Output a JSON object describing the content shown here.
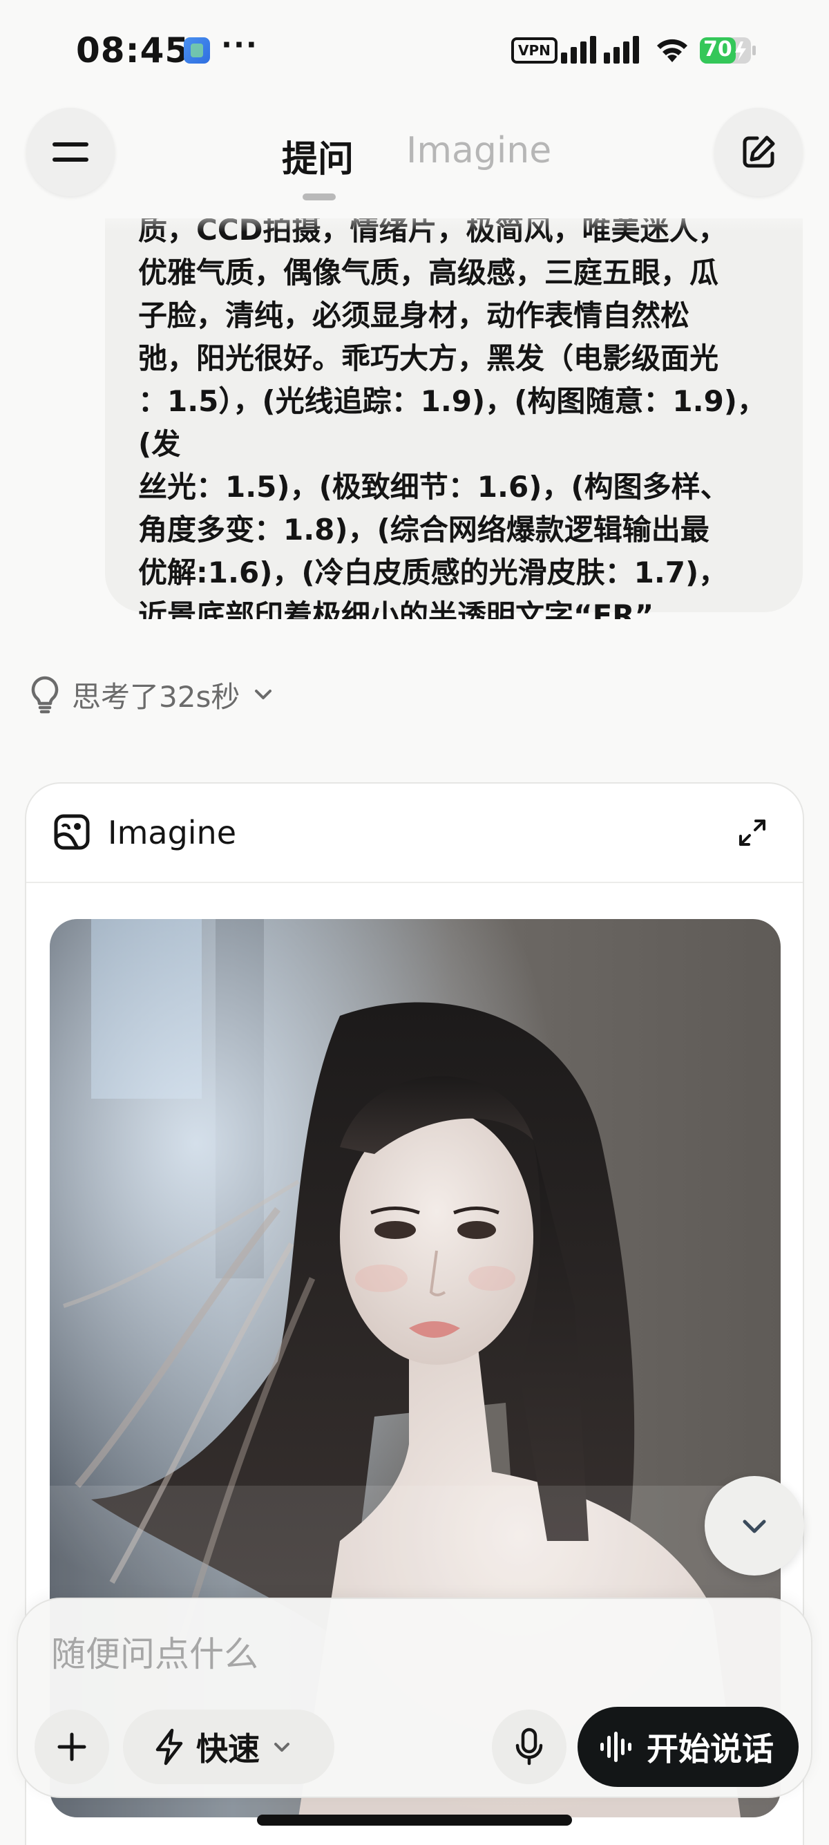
{
  "status_bar": {
    "time": "08:45",
    "more": "···",
    "vpn": "VPN",
    "battery": "70"
  },
  "header": {
    "tabs": [
      {
        "label": "提问",
        "active": true
      },
      {
        "label": "Imagine",
        "active": false
      }
    ],
    "icons": {
      "menu": "menu-icon",
      "edit": "edit-icon"
    }
  },
  "message": {
    "text": "质，CCD拍摄，情绪片，极简风，唯美迷人，\n优雅气质，偶像气质，高级感，三庭五眼，瓜\n子脸，清纯，必须显身材，动作表情自然松\n弛，阳光很好。乖巧大方，黑发（电影级面光\n：1.5），(光线追踪：1.9)，(构图随意：1.9)，(发\n丝光：1.5)，(极致细节：1.6)，(构图多样、\n角度多变：1.8)，(综合网络爆款逻辑输出最\n优解:1.6)，(冷白皮质感的光滑皮肤：1.7)，\n近景底部印着极细小的半透明文字“ER”"
  },
  "thinking": {
    "label": "思考了32s秒"
  },
  "imagine_card": {
    "title": "Imagine"
  },
  "composer": {
    "placeholder": "随便问点什么",
    "mode_label": "快速",
    "talk_label": "开始说话"
  },
  "colors": {
    "background": "#f9f9f8",
    "bubble": "#f0f0ee",
    "talk_button": "#131617"
  }
}
